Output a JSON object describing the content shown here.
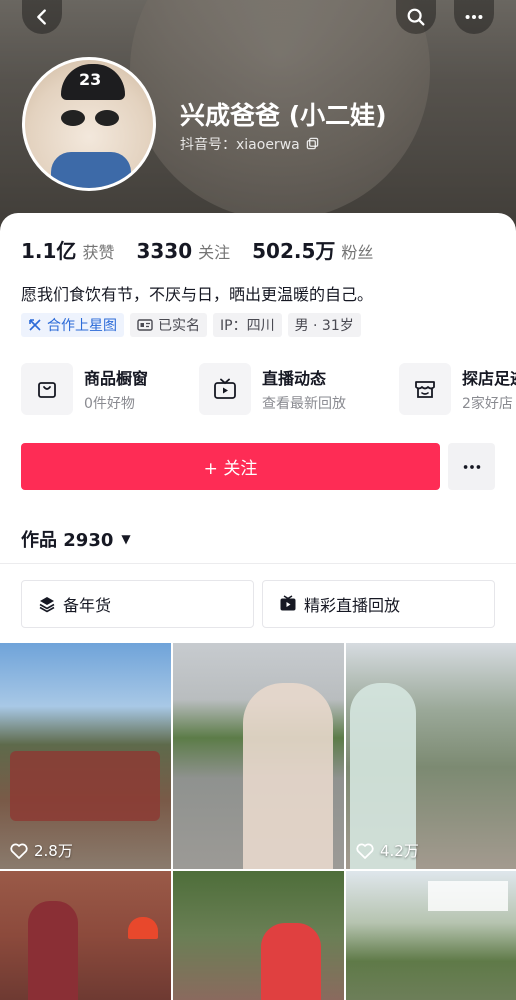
{
  "profile": {
    "name": "兴成爸爸 (小二娃)",
    "handle_label": "抖音号：xiaoerwa",
    "avatar_badge": "23"
  },
  "stats": [
    {
      "value": "1.1亿",
      "label": "获赞"
    },
    {
      "value": "3330",
      "label": "关注"
    },
    {
      "value": "502.5万",
      "label": "粉丝"
    }
  ],
  "bio": "愿我们食饮有节，不厌与日，晒出更温暖的自己。",
  "tags": [
    {
      "label": "合作上星图",
      "icon": "star-map-icon"
    },
    {
      "label": "已实名",
      "icon": "id-card-icon"
    },
    {
      "label": "IP：四川",
      "icon": ""
    },
    {
      "label": "男 · 31岁",
      "icon": ""
    }
  ],
  "services": [
    {
      "title": "商品橱窗",
      "subtitle": "0件好物",
      "icon": "shopping-bag-icon"
    },
    {
      "title": "直播动态",
      "subtitle": "查看最新回放",
      "icon": "tv-icon"
    },
    {
      "title": "探店足迹",
      "subtitle": "2家好店",
      "icon": "store-icon"
    }
  ],
  "follow_button": "+ 关注",
  "works_label": "作品 2930",
  "collections": [
    {
      "label": "备年货",
      "icon": "layers-icon"
    },
    {
      "label": "精彩直播回放",
      "icon": "live-replay-icon"
    }
  ],
  "videos": [
    {
      "likes": "2.8万"
    },
    {
      "likes": ""
    },
    {
      "likes": "4.2万"
    },
    {
      "likes": ""
    },
    {
      "likes": ""
    },
    {
      "likes": ""
    }
  ],
  "colors": {
    "accent": "#fe2c55",
    "tag_blue": "#2c6bd8"
  }
}
